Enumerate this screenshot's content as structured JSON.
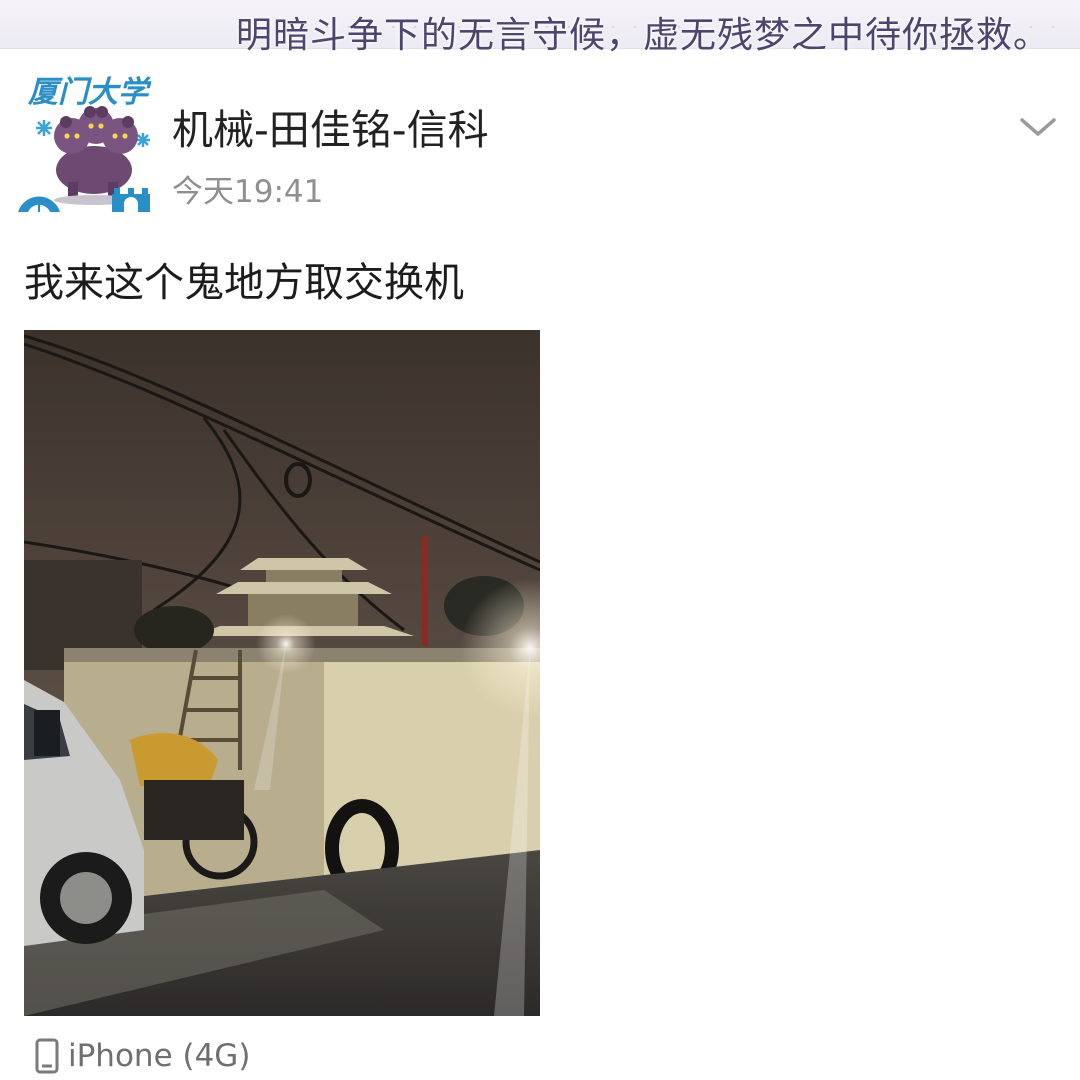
{
  "banner": {
    "text": "明暗斗争下的无言守候，虚无残梦之中待你拯救。"
  },
  "post": {
    "author": "机械-田佳铭-信科",
    "avatar": {
      "badge_text": "厦门大学",
      "icon": "xmu-cerberus-avatar"
    },
    "timestamp": "今天19:41",
    "menu_icon": "chevron-down-icon",
    "text": "我来这个鬼地方取交换机",
    "photo": {
      "description_icon": "night-alley-photo"
    },
    "device": {
      "icon": "phone-icon",
      "label": "iPhone (4G)"
    }
  },
  "colors": {
    "author_text": "#222222",
    "timestamp_text": "#8f8f8f",
    "device_text": "#6f6f6f",
    "avatar_badge": "#2a8fc7",
    "avatar_creature": "#6e4a72",
    "banner_text": "#4d4470"
  }
}
